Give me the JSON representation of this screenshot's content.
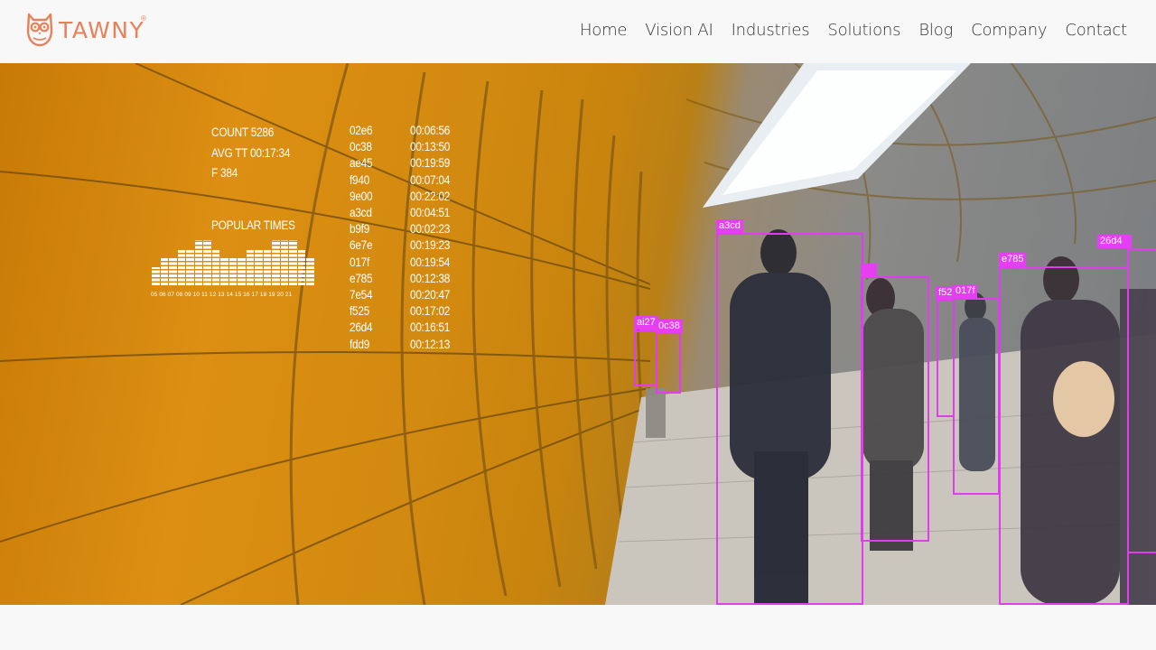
{
  "brand": {
    "name": "TAWNY",
    "reg": "®"
  },
  "nav": [
    "Home",
    "Vision AI",
    "Industries",
    "Solutions",
    "Blog",
    "Company",
    "Contact"
  ],
  "overlay": {
    "stats": [
      "COUNT 5286",
      "AVG TT 00:17:34",
      "F 384"
    ],
    "popular_label": "POPULAR TIMES",
    "bar_levels": [
      2,
      3,
      3,
      4,
      4,
      5,
      5,
      4,
      3,
      3,
      3,
      4,
      4,
      4,
      5,
      5,
      5,
      4,
      3
    ],
    "bar_hours": "05 06 07 08 09 10 11 12 13 14 15 16 17 18 19 20 21",
    "ids": [
      "02e6",
      "0c38",
      "ae45",
      "f940",
      "9e00",
      "a3cd",
      "b9f9",
      "6e7e",
      "017f",
      "e785",
      "7e54",
      "f525",
      "26d4",
      "fdd9"
    ],
    "times": [
      "00:06:56",
      "00:13:50",
      "00:19:59",
      "00:07:04",
      "00:22:02",
      "00:04:51",
      "00:02:23",
      "00:19:23",
      "00:19:54",
      "00:12:38",
      "00:20:47",
      "00:17:02",
      "00:16:51",
      "00:12:13"
    ]
  },
  "detections": [
    "a3cd",
    "ai27",
    "0c38",
    "f52",
    "017f",
    "e785",
    "26d4"
  ],
  "colors": {
    "accent": "#e8805a",
    "detection": "#e23cf0"
  }
}
